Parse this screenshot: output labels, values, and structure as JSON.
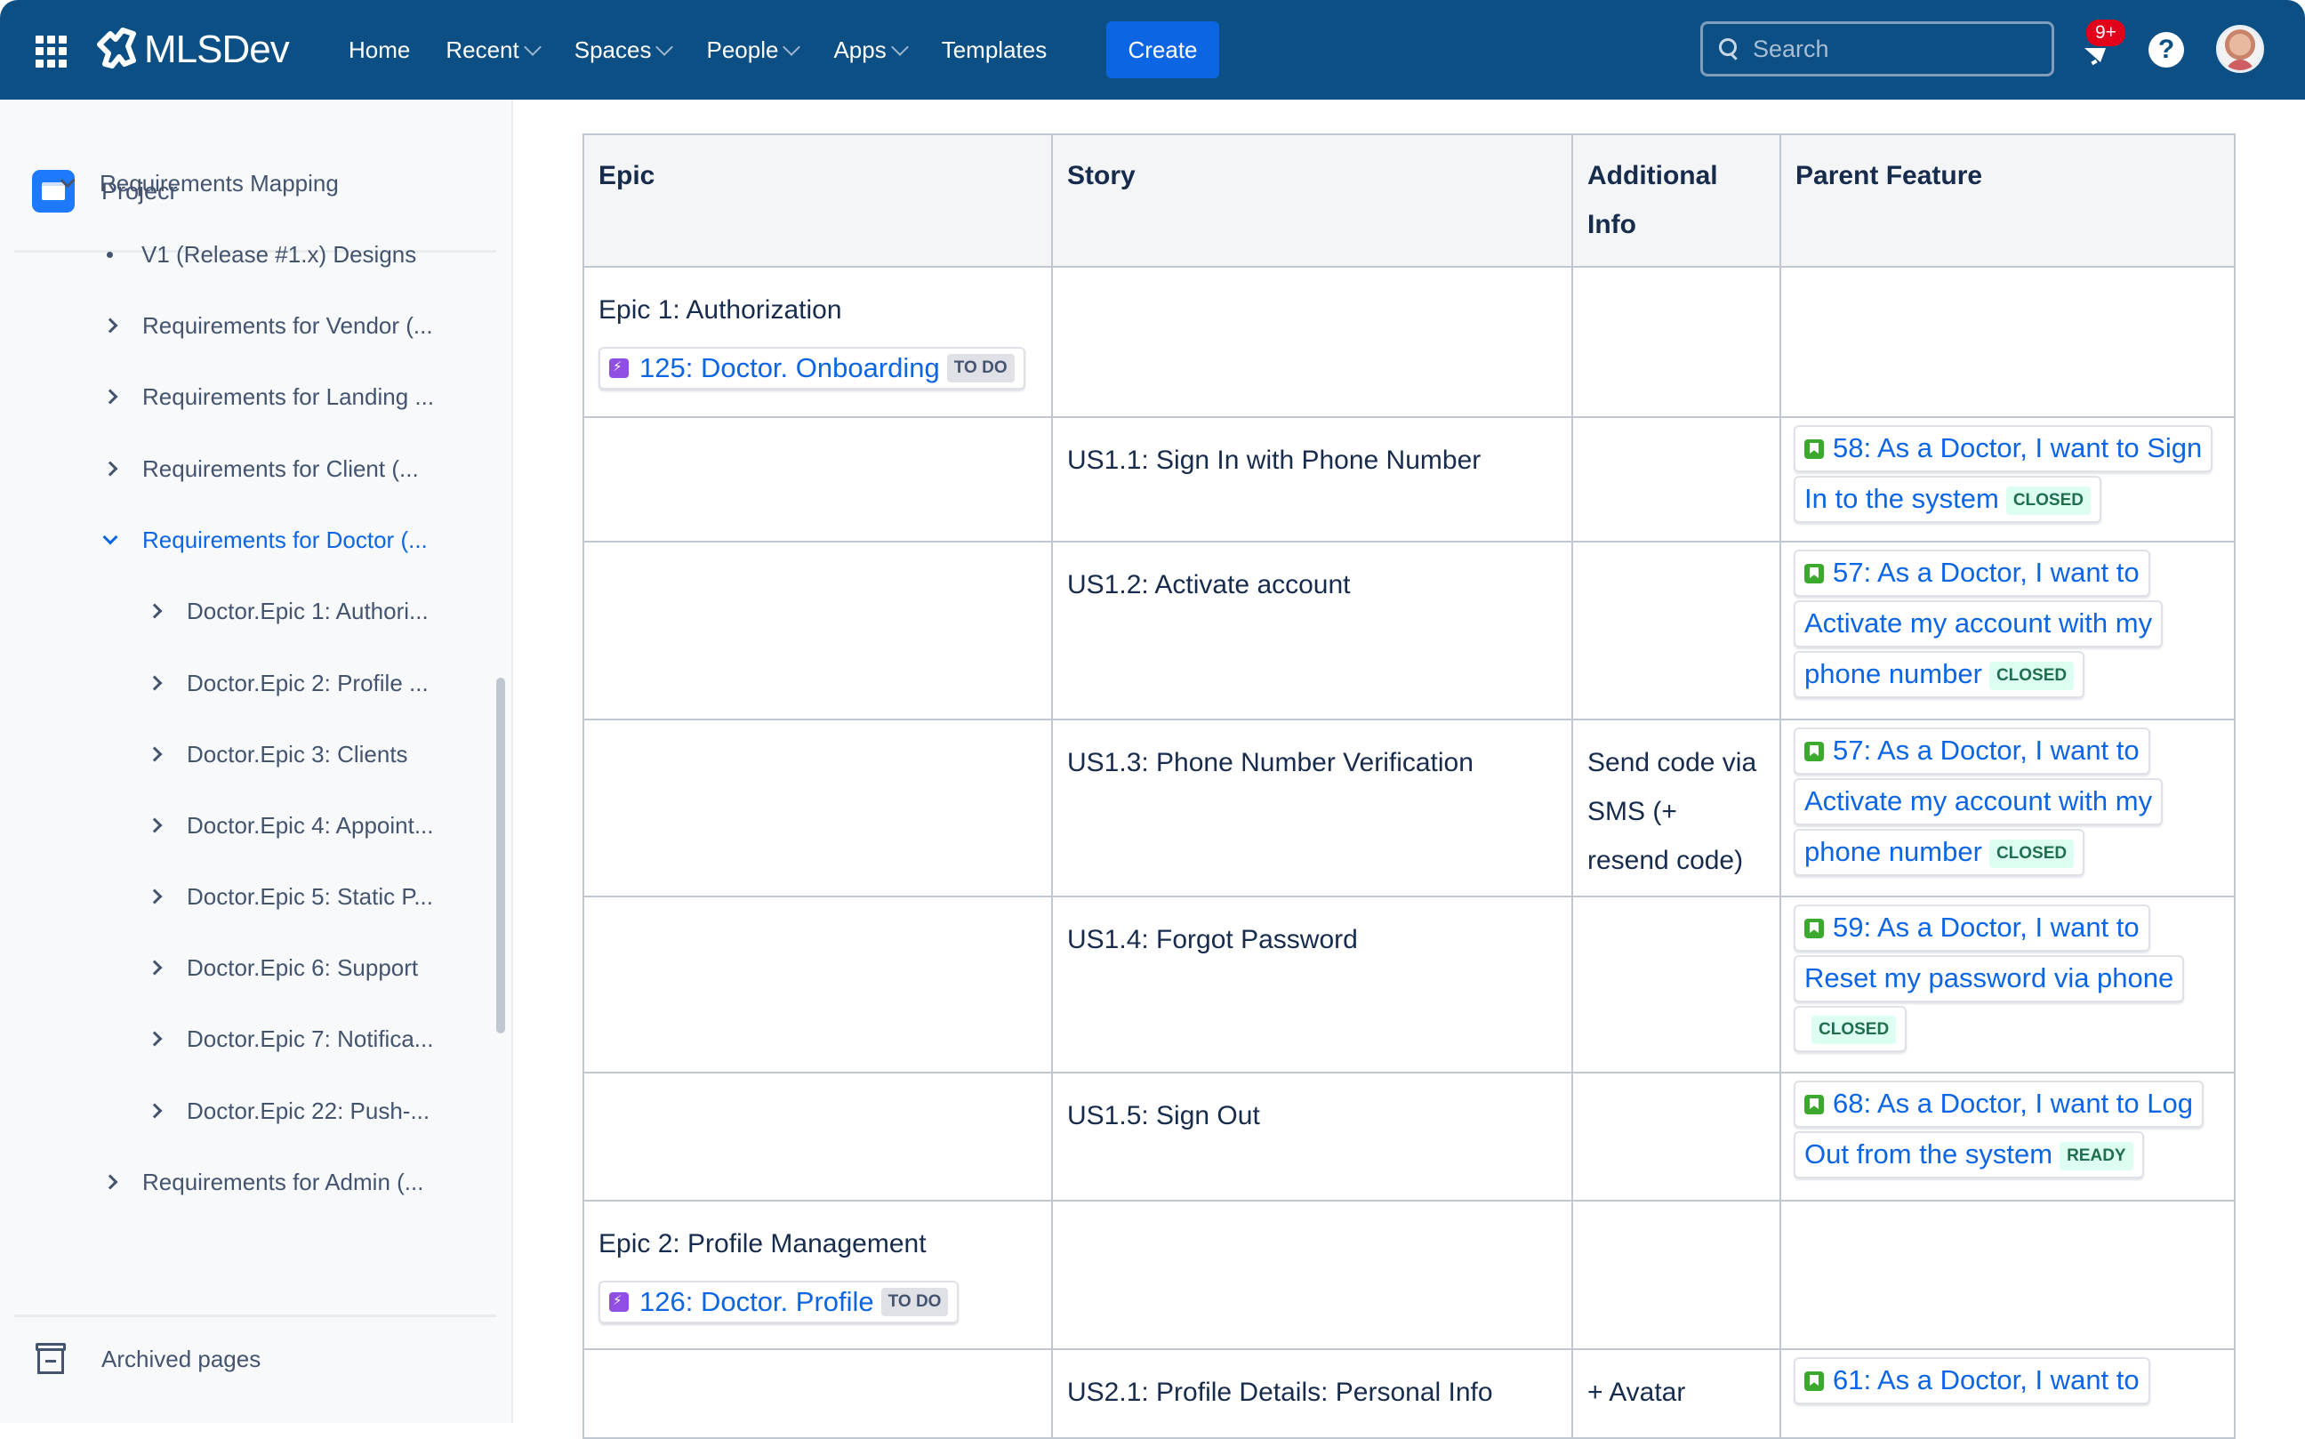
{
  "header": {
    "brand": "MLSDev",
    "nav": [
      {
        "label": "Home",
        "has_dropdown": false
      },
      {
        "label": "Recent",
        "has_dropdown": true
      },
      {
        "label": "Spaces",
        "has_dropdown": true
      },
      {
        "label": "People",
        "has_dropdown": true
      },
      {
        "label": "Apps",
        "has_dropdown": true
      },
      {
        "label": "Templates",
        "has_dropdown": false
      }
    ],
    "create_label": "Create",
    "search_placeholder": "Search",
    "notifications_badge": "9+",
    "help_glyph": "?",
    "colors": {
      "header_bg": "#0b4f84",
      "create_bg": "#0c66e4",
      "badge_bg": "#e2001a"
    }
  },
  "sidebar": {
    "space_name": "Projecr",
    "tree": [
      {
        "label": "Requirements Mapping",
        "level": 0,
        "toggle": "expanded",
        "active": false
      },
      {
        "label": "V1 (Release #1.x) Designs",
        "level": 1,
        "toggle": "bullet",
        "active": false
      },
      {
        "label": "Requirements for Vendor (...",
        "level": 1,
        "toggle": "collapsed",
        "active": false
      },
      {
        "label": "Requirements for Landing ...",
        "level": 1,
        "toggle": "collapsed",
        "active": false
      },
      {
        "label": "Requirements for Client (...",
        "level": 1,
        "toggle": "collapsed",
        "active": false
      },
      {
        "label": "Requirements for Doctor (...",
        "level": 1,
        "toggle": "expanded",
        "active": true
      },
      {
        "label": "Doctor.Epic 1: Authori...",
        "level": 2,
        "toggle": "collapsed",
        "active": false
      },
      {
        "label": "Doctor.Epic 2: Profile ...",
        "level": 2,
        "toggle": "collapsed",
        "active": false
      },
      {
        "label": "Doctor.Epic 3: Clients",
        "level": 2,
        "toggle": "collapsed",
        "active": false
      },
      {
        "label": "Doctor.Epic 4: Appoint...",
        "level": 2,
        "toggle": "collapsed",
        "active": false
      },
      {
        "label": "Doctor.Epic 5: Static P...",
        "level": 2,
        "toggle": "collapsed",
        "active": false
      },
      {
        "label": "Doctor.Epic 6: Support",
        "level": 2,
        "toggle": "collapsed",
        "active": false
      },
      {
        "label": "Doctor.Epic 7: Notifica...",
        "level": 2,
        "toggle": "collapsed",
        "active": false
      },
      {
        "label": "Doctor.Epic 22: Push-...",
        "level": 2,
        "toggle": "collapsed",
        "active": false
      },
      {
        "label": "Requirements for Admin (...",
        "level": 1,
        "toggle": "collapsed",
        "active": false
      }
    ],
    "archived_label": "Archived pages"
  },
  "table": {
    "headers": [
      "Epic",
      "Story",
      "Additional Info",
      "Parent Feature"
    ],
    "rows": [
      {
        "epic": {
          "title": "Epic 1: Authorization",
          "issue": {
            "key": "125",
            "text": "125: Doctor. Onboarding",
            "status": "TO DO",
            "type": "epic"
          }
        },
        "story": "",
        "additional": "",
        "parent": null
      },
      {
        "epic": null,
        "story": "US1.1: Sign In with Phone Number",
        "additional": "",
        "parent": {
          "lines": [
            "58: As a Doctor, I want to Sign",
            "In to the system"
          ],
          "status": "CLOSED",
          "type": "story"
        }
      },
      {
        "epic": null,
        "story": "US1.2: Activate account",
        "additional": "",
        "parent": {
          "lines": [
            "57: As a Doctor, I want to",
            "Activate my account with my",
            "phone number"
          ],
          "status": "CLOSED",
          "type": "story"
        }
      },
      {
        "epic": null,
        "story": "US1.3: Phone Number Verification",
        "additional": "Send code via SMS (+ resend code)",
        "parent": {
          "lines": [
            "57: As a Doctor, I want to",
            "Activate my account with my",
            "phone number"
          ],
          "status": "CLOSED",
          "type": "story"
        }
      },
      {
        "epic": null,
        "story": "US1.4: Forgot Password",
        "additional": "",
        "parent": {
          "lines": [
            "59: As a Doctor, I want to",
            "Reset my password via phone",
            ""
          ],
          "status": "CLOSED",
          "type": "story"
        }
      },
      {
        "epic": null,
        "story": "US1.5: Sign Out",
        "additional": "",
        "parent": {
          "lines": [
            "68: As a Doctor, I want to Log",
            "Out from the system"
          ],
          "status": "READY",
          "type": "story"
        }
      },
      {
        "epic": {
          "title": "Epic 2: Profile Management",
          "issue": {
            "key": "126",
            "text": "126: Doctor. Profile",
            "status": "TO DO",
            "type": "epic"
          }
        },
        "story": "",
        "additional": "",
        "parent": null
      },
      {
        "epic": null,
        "story": "US2.1: Profile Details: Personal Info",
        "additional": "+ Avatar",
        "parent": {
          "lines": [
            "61: As a Doctor, I want to"
          ],
          "status": "",
          "type": "story"
        }
      }
    ]
  }
}
